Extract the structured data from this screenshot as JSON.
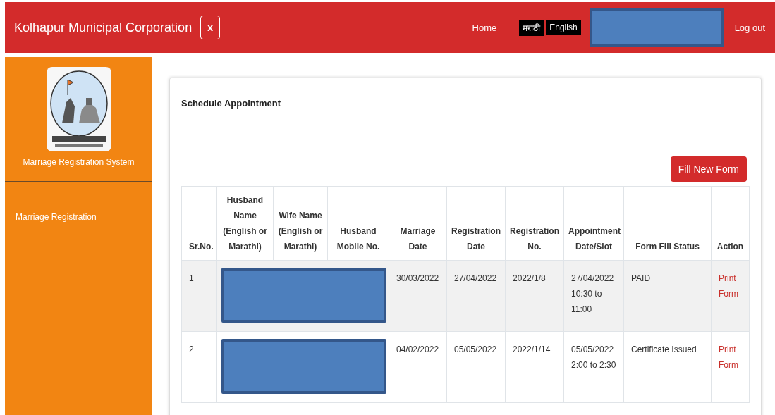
{
  "header": {
    "title": "Kolhapur Municipal Corporation",
    "close_label": "x",
    "nav": [
      {
        "label": "Home",
        "kind": "link"
      },
      {
        "label": "मराठी",
        "kind": "lang"
      },
      {
        "label": "English",
        "kind": "lang"
      }
    ],
    "logout": "Log out"
  },
  "sidebar": {
    "system_name": "Marriage Registration System",
    "items": [
      {
        "label": "Marriage Registration"
      }
    ]
  },
  "card": {
    "title": "Schedule Appointment",
    "new_button": "Fill New Form",
    "columns": [
      "Sr.No.",
      "Husband Name (English or Marathi)",
      "Wife Name (English or Marathi)",
      "Husband Mobile No.",
      "Marriage Date",
      "Registration Date",
      "Registration No.",
      "Appointment Date/Slot",
      "Form Fill Status",
      "Action"
    ],
    "rows": [
      {
        "sr": "1",
        "marriage_date": "30/03/2022",
        "registration_date": "27/04/2022",
        "registration_no": "2022/1/8",
        "slot": [
          "27/04/2022",
          "10:30 to",
          "11:00"
        ],
        "status": "PAID",
        "action": [
          "Print",
          "Form"
        ]
      },
      {
        "sr": "2",
        "marriage_date": "04/02/2022",
        "registration_date": "05/05/2022",
        "registration_no": "2022/1/14",
        "slot": [
          "05/05/2022",
          "2:00 to 2:30"
        ],
        "status": "Certificate Issued",
        "action": [
          "Print",
          "Form"
        ]
      }
    ]
  }
}
